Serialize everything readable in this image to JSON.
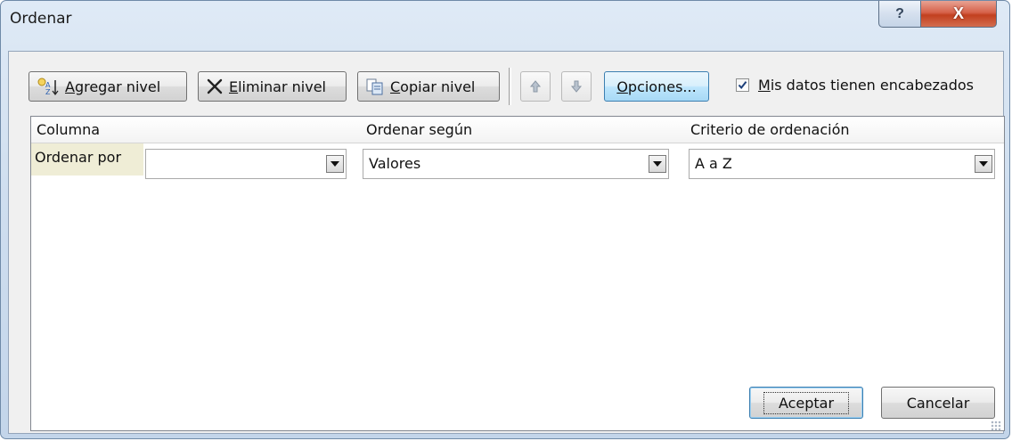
{
  "window": {
    "title": "Ordenar",
    "help_glyph": "?",
    "close_glyph": "X"
  },
  "toolbar": {
    "add_level": {
      "accel": "A",
      "rest": "gregar nivel"
    },
    "delete_level": {
      "accel": "E",
      "rest": "liminar nivel"
    },
    "copy_level": {
      "accel": "C",
      "rest": "opiar nivel"
    },
    "options": {
      "accel": "O",
      "rest": "pciones..."
    },
    "headers_checkbox": {
      "accel": "M",
      "rest": "is datos tienen encabezados",
      "checked": true
    }
  },
  "grid": {
    "columns": [
      "Columna",
      "Ordenar según",
      "Criterio de ordenación"
    ],
    "rows": [
      {
        "label": "Ordenar por",
        "column_value": "",
        "sort_on": "Valores",
        "order": "A a Z"
      }
    ]
  },
  "buttons": {
    "ok": "Aceptar",
    "cancel": "Cancelar"
  },
  "colors": {
    "row_label_bg": "#efedd6",
    "options_button": "#bee6fd",
    "close_button": "#c2401f"
  }
}
